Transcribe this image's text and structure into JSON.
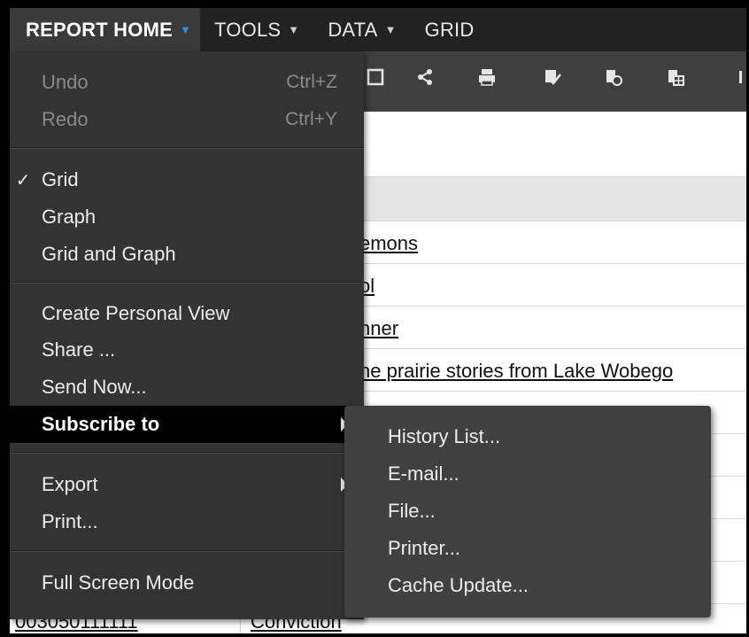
{
  "menubar": {
    "items": [
      {
        "label": "REPORT HOME",
        "active": true
      },
      {
        "label": "TOOLS",
        "active": false
      },
      {
        "label": "DATA",
        "active": false
      },
      {
        "label": "GRID",
        "active": false
      }
    ]
  },
  "toolbar": {
    "icons": [
      "save-icon",
      "share-icon",
      "print-icon",
      "send-now-icon",
      "subscribe-icon",
      "export-icon"
    ]
  },
  "grid": {
    "visible_text": [
      "emons",
      "ol",
      "nner",
      "he prairie stories from Lake Wobego"
    ],
    "bottom_row": {
      "id": "003050111111",
      "name": "Conviction"
    }
  },
  "dropdown": {
    "undo": {
      "label": "Undo",
      "shortcut": "Ctrl+Z"
    },
    "redo": {
      "label": "Redo",
      "shortcut": "Ctrl+Y"
    },
    "grid": {
      "label": "Grid",
      "checked": true,
      "check_glyph": "✓"
    },
    "graph": {
      "label": "Graph"
    },
    "grid_and_graph": {
      "label": "Grid and Graph"
    },
    "create_personal_view": {
      "label": "Create Personal View"
    },
    "share": {
      "label": "Share ..."
    },
    "send_now": {
      "label": "Send Now..."
    },
    "subscribe_to": {
      "label": "Subscribe to"
    },
    "export": {
      "label": "Export"
    },
    "print": {
      "label": "Print..."
    },
    "full_screen_mode": {
      "label": "Full Screen Mode"
    }
  },
  "submenu": {
    "history_list": {
      "label": "History List..."
    },
    "email": {
      "label": "E-mail..."
    },
    "file": {
      "label": "File..."
    },
    "printer": {
      "label": "Printer..."
    },
    "cache_update": {
      "label": "Cache Update..."
    }
  },
  "colors": {
    "menubar_bg": "#222222",
    "menu_bg": "#333333",
    "submenu_bg": "#404040",
    "highlight_bg": "#000000",
    "accent_caret": "#3d8fd6",
    "disabled_text": "#8a8a8a"
  }
}
